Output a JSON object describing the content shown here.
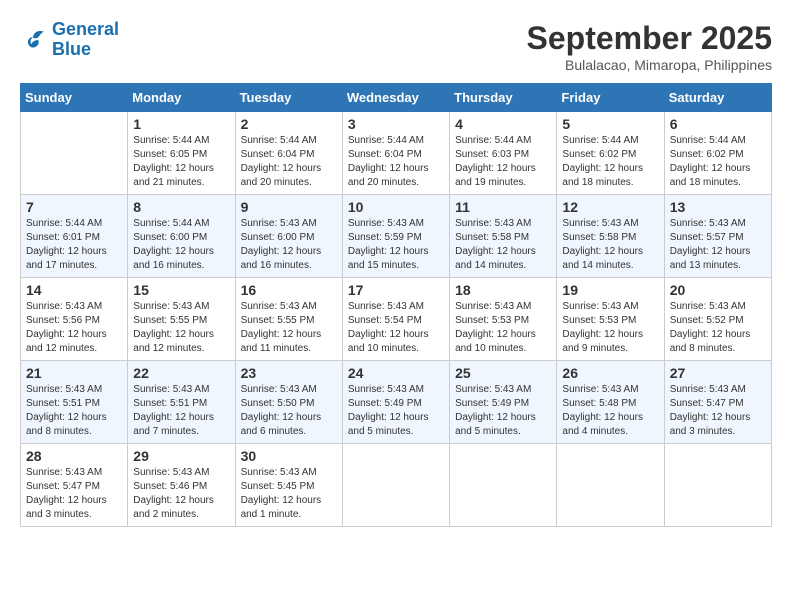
{
  "header": {
    "logo_line1": "General",
    "logo_line2": "Blue",
    "main_title": "September 2025",
    "subtitle": "Bulalacao, Mimaropa, Philippines"
  },
  "days_of_week": [
    "Sunday",
    "Monday",
    "Tuesday",
    "Wednesday",
    "Thursday",
    "Friday",
    "Saturday"
  ],
  "weeks": [
    [
      {
        "day": "",
        "info": ""
      },
      {
        "day": "1",
        "info": "Sunrise: 5:44 AM\nSunset: 6:05 PM\nDaylight: 12 hours\nand 21 minutes."
      },
      {
        "day": "2",
        "info": "Sunrise: 5:44 AM\nSunset: 6:04 PM\nDaylight: 12 hours\nand 20 minutes."
      },
      {
        "day": "3",
        "info": "Sunrise: 5:44 AM\nSunset: 6:04 PM\nDaylight: 12 hours\nand 20 minutes."
      },
      {
        "day": "4",
        "info": "Sunrise: 5:44 AM\nSunset: 6:03 PM\nDaylight: 12 hours\nand 19 minutes."
      },
      {
        "day": "5",
        "info": "Sunrise: 5:44 AM\nSunset: 6:02 PM\nDaylight: 12 hours\nand 18 minutes."
      },
      {
        "day": "6",
        "info": "Sunrise: 5:44 AM\nSunset: 6:02 PM\nDaylight: 12 hours\nand 18 minutes."
      }
    ],
    [
      {
        "day": "7",
        "info": "Sunrise: 5:44 AM\nSunset: 6:01 PM\nDaylight: 12 hours\nand 17 minutes."
      },
      {
        "day": "8",
        "info": "Sunrise: 5:44 AM\nSunset: 6:00 PM\nDaylight: 12 hours\nand 16 minutes."
      },
      {
        "day": "9",
        "info": "Sunrise: 5:43 AM\nSunset: 6:00 PM\nDaylight: 12 hours\nand 16 minutes."
      },
      {
        "day": "10",
        "info": "Sunrise: 5:43 AM\nSunset: 5:59 PM\nDaylight: 12 hours\nand 15 minutes."
      },
      {
        "day": "11",
        "info": "Sunrise: 5:43 AM\nSunset: 5:58 PM\nDaylight: 12 hours\nand 14 minutes."
      },
      {
        "day": "12",
        "info": "Sunrise: 5:43 AM\nSunset: 5:58 PM\nDaylight: 12 hours\nand 14 minutes."
      },
      {
        "day": "13",
        "info": "Sunrise: 5:43 AM\nSunset: 5:57 PM\nDaylight: 12 hours\nand 13 minutes."
      }
    ],
    [
      {
        "day": "14",
        "info": "Sunrise: 5:43 AM\nSunset: 5:56 PM\nDaylight: 12 hours\nand 12 minutes."
      },
      {
        "day": "15",
        "info": "Sunrise: 5:43 AM\nSunset: 5:55 PM\nDaylight: 12 hours\nand 12 minutes."
      },
      {
        "day": "16",
        "info": "Sunrise: 5:43 AM\nSunset: 5:55 PM\nDaylight: 12 hours\nand 11 minutes."
      },
      {
        "day": "17",
        "info": "Sunrise: 5:43 AM\nSunset: 5:54 PM\nDaylight: 12 hours\nand 10 minutes."
      },
      {
        "day": "18",
        "info": "Sunrise: 5:43 AM\nSunset: 5:53 PM\nDaylight: 12 hours\nand 10 minutes."
      },
      {
        "day": "19",
        "info": "Sunrise: 5:43 AM\nSunset: 5:53 PM\nDaylight: 12 hours\nand 9 minutes."
      },
      {
        "day": "20",
        "info": "Sunrise: 5:43 AM\nSunset: 5:52 PM\nDaylight: 12 hours\nand 8 minutes."
      }
    ],
    [
      {
        "day": "21",
        "info": "Sunrise: 5:43 AM\nSunset: 5:51 PM\nDaylight: 12 hours\nand 8 minutes."
      },
      {
        "day": "22",
        "info": "Sunrise: 5:43 AM\nSunset: 5:51 PM\nDaylight: 12 hours\nand 7 minutes."
      },
      {
        "day": "23",
        "info": "Sunrise: 5:43 AM\nSunset: 5:50 PM\nDaylight: 12 hours\nand 6 minutes."
      },
      {
        "day": "24",
        "info": "Sunrise: 5:43 AM\nSunset: 5:49 PM\nDaylight: 12 hours\nand 5 minutes."
      },
      {
        "day": "25",
        "info": "Sunrise: 5:43 AM\nSunset: 5:49 PM\nDaylight: 12 hours\nand 5 minutes."
      },
      {
        "day": "26",
        "info": "Sunrise: 5:43 AM\nSunset: 5:48 PM\nDaylight: 12 hours\nand 4 minutes."
      },
      {
        "day": "27",
        "info": "Sunrise: 5:43 AM\nSunset: 5:47 PM\nDaylight: 12 hours\nand 3 minutes."
      }
    ],
    [
      {
        "day": "28",
        "info": "Sunrise: 5:43 AM\nSunset: 5:47 PM\nDaylight: 12 hours\nand 3 minutes."
      },
      {
        "day": "29",
        "info": "Sunrise: 5:43 AM\nSunset: 5:46 PM\nDaylight: 12 hours\nand 2 minutes."
      },
      {
        "day": "30",
        "info": "Sunrise: 5:43 AM\nSunset: 5:45 PM\nDaylight: 12 hours\nand 1 minute."
      },
      {
        "day": "",
        "info": ""
      },
      {
        "day": "",
        "info": ""
      },
      {
        "day": "",
        "info": ""
      },
      {
        "day": "",
        "info": ""
      }
    ]
  ]
}
